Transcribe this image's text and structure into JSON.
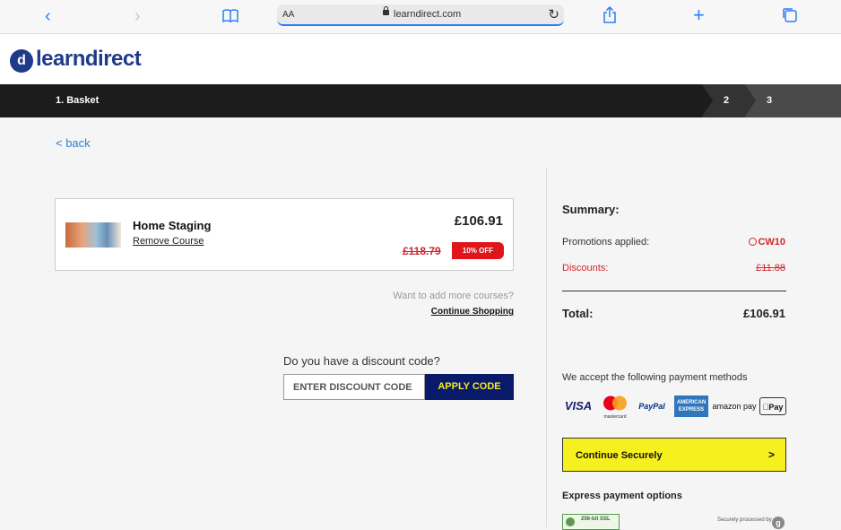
{
  "browser": {
    "text_size_label": "AA",
    "url": "learndirect.com",
    "icons": [
      "back-icon",
      "forward-icon",
      "bookmarks-icon",
      "lock-icon",
      "reload-icon",
      "share-icon",
      "new-tab-icon",
      "tabs-icon"
    ]
  },
  "brand": {
    "logo_mark": "d",
    "name": "learndirect",
    "color": "#1e3a8a"
  },
  "steps": {
    "step1": "1. Basket",
    "step2": "2",
    "step3": "3"
  },
  "back_link": "< back",
  "basket": {
    "course_title": "Home Staging",
    "remove_label": "Remove Course",
    "price": "£106.91",
    "old_price": "£118.79",
    "discount_badge": "10% OFF",
    "more_prompt": "Want to add more courses?",
    "continue_shopping": "Continue Shopping"
  },
  "discount": {
    "question": "Do you have a discount code?",
    "placeholder": "ENTER DISCOUNT CODE",
    "apply_label": "APPLY CODE"
  },
  "summary": {
    "title": "Summary:",
    "promotions_label": "Promotions applied:",
    "promotion_code": "CW10",
    "discounts_label": "Discounts:",
    "discounts_value": "£11.88",
    "total_label": "Total:",
    "total_value": "£106.91",
    "accept_text": "We accept the following payment methods",
    "payment_methods": [
      "VISA",
      "mastercard",
      "PayPal",
      "AMERICAN EXPRESS",
      "amazon pay",
      "Pay"
    ],
    "continue_label": "Continue Securely",
    "continue_arrow": ">",
    "express_title": "Express payment options",
    "ssl_text": "256-bit SSL",
    "secured_text": "Securely processed by",
    "secured_mark": "g"
  },
  "colors": {
    "accent_yellow": "#f5f01e",
    "navy": "#0a1a6b",
    "red": "#d0282e",
    "link_blue": "#2a7fd4"
  }
}
